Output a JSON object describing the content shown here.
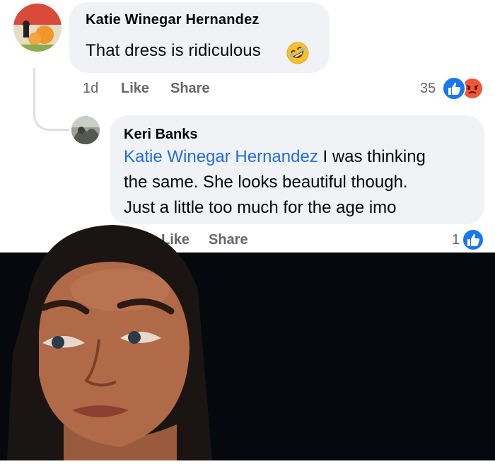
{
  "comment": {
    "author": "Katie Winegar Hernandez",
    "text": "That dress is ridiculous",
    "emoji_icon": "rolling-on-floor-laughing",
    "time": "1d",
    "like_label": "Like",
    "share_label": "Share",
    "reaction_count": "35",
    "reactions": [
      "like",
      "angry"
    ]
  },
  "reply": {
    "author": "Keri Banks",
    "mention": "Katie Winegar Hernandez",
    "text_line1": " I was thinking",
    "text_line2": "the same. She looks beautiful though.",
    "text_line3": "Just a little too much for the age imo",
    "like_label": "Like",
    "share_label": "Share",
    "reaction_count": "1",
    "reactions": [
      "like"
    ]
  },
  "colors": {
    "bubble": "#f0f2f5",
    "mention": "#216fdb",
    "secondary_text": "#65676b",
    "like_blue": "#1877f2",
    "video_bg": "#05080c"
  }
}
